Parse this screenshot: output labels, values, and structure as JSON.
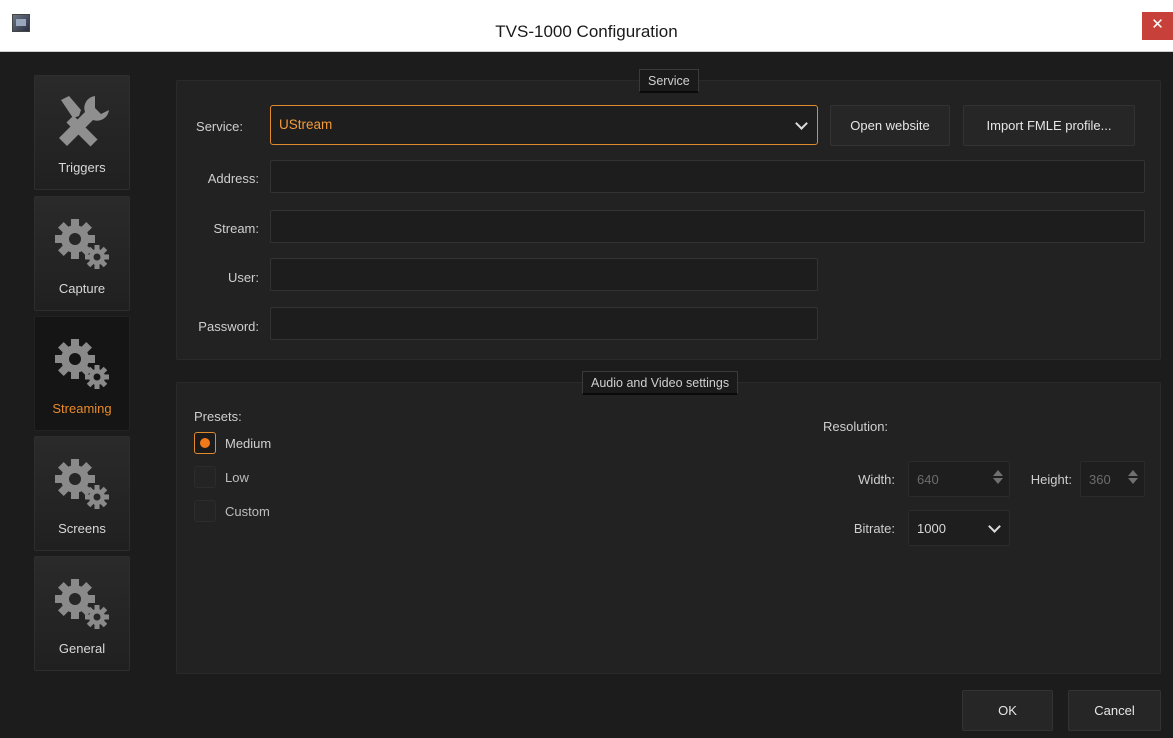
{
  "window": {
    "title": "TVS-1000 Configuration",
    "close_glyph": "✕"
  },
  "sidebar": {
    "items": [
      {
        "label": "Triggers",
        "icon": "tools-icon",
        "active": false
      },
      {
        "label": "Capture",
        "icon": "gears-icon",
        "active": false
      },
      {
        "label": "Streaming",
        "icon": "gears-icon",
        "active": true
      },
      {
        "label": "Screens",
        "icon": "gears-icon",
        "active": false
      },
      {
        "label": "General",
        "icon": "gears-icon",
        "active": false
      }
    ]
  },
  "service": {
    "group_title": "Service",
    "service_label": "Service:",
    "service_value": "UStream",
    "open_website": "Open website",
    "import_fmle": "Import FMLE profile...",
    "address_label": "Address:",
    "address_value": "",
    "stream_label": "Stream:",
    "stream_value": "",
    "user_label": "User:",
    "user_value": "",
    "password_label": "Password:",
    "password_value": ""
  },
  "av": {
    "group_title": "Audio and Video settings",
    "presets_label": "Presets:",
    "presets": [
      {
        "label": "Medium",
        "checked": true
      },
      {
        "label": "Low",
        "checked": false
      },
      {
        "label": "Custom",
        "checked": false
      }
    ],
    "resolution_label": "Resolution:",
    "width_label": "Width:",
    "width_value": "640",
    "height_label": "Height:",
    "height_value": "360",
    "bitrate_label": "Bitrate:",
    "bitrate_value": "1000"
  },
  "footer": {
    "ok": "OK",
    "cancel": "Cancel"
  },
  "colors": {
    "accent": "#e88a2a",
    "background": "#1c1c1c"
  }
}
